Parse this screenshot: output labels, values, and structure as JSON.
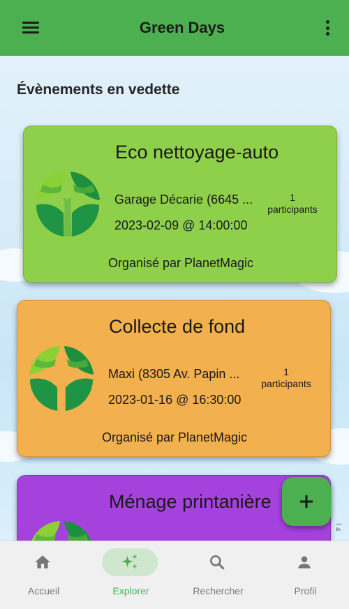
{
  "app_bar": {
    "title": "Green Days",
    "menu_icon": "hamburger-menu-icon",
    "more_icon": "more-vertical-icon"
  },
  "section": {
    "title": "Évènements en vedette"
  },
  "events": [
    {
      "title": "Eco nettoyage-auto",
      "location": "Garage Décarie (6645 ...",
      "date": "2023-02-09 @ 14:00:00",
      "participants_count": "1",
      "participants_label": "participants",
      "organizer": "Organisé par PlanetMagic",
      "color": "#8ed04a"
    },
    {
      "title": "Collecte de fond",
      "location": "Maxi (8305 Av. Papin ...",
      "date": "2023-01-16 @ 16:30:00",
      "participants_count": "1",
      "participants_label": "participants",
      "organizer": "Organisé par PlanetMagic",
      "color": "#f2b04e"
    },
    {
      "title": "Ménage printanière",
      "color": "#a542dd"
    }
  ],
  "fab": {
    "label": "+",
    "icon": "add-icon",
    "color": "#4caf50"
  },
  "side_glyph": "ᅮ4",
  "bottom_nav": [
    {
      "label": "Accueil",
      "icon": "home-icon",
      "active": false
    },
    {
      "label": "Explorer",
      "icon": "sparkle-icon",
      "active": true
    },
    {
      "label": "Rechercher",
      "icon": "search-icon",
      "active": false
    },
    {
      "label": "Profil",
      "icon": "person-icon",
      "active": false
    }
  ],
  "colors": {
    "primary": "#4caf50",
    "nav_active_pill": "#cfe6cf",
    "nav_inactive": "#777777"
  }
}
